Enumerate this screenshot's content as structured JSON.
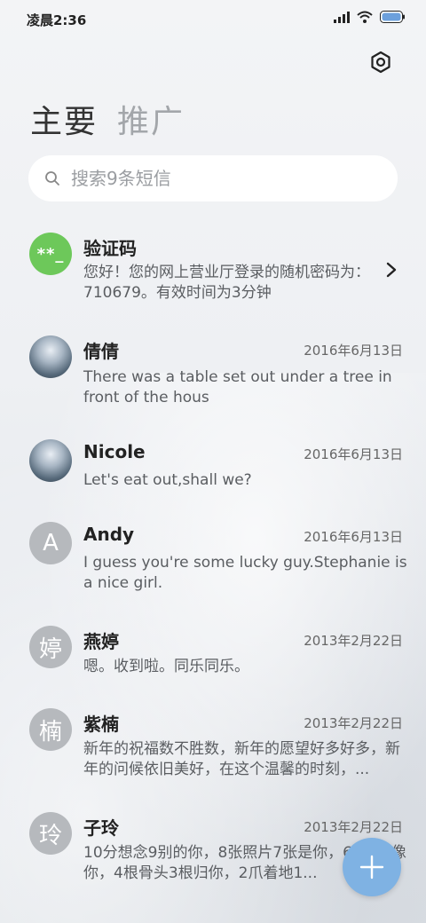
{
  "status_bar": {
    "time": "凌晨2:36"
  },
  "tabs": [
    {
      "label": "主要",
      "active": true
    },
    {
      "label": "推广",
      "active": false
    }
  ],
  "search": {
    "placeholder": "搜索9条短信"
  },
  "messages": [
    {
      "name": "验证码",
      "avatar_text": "**_",
      "avatar_type": "code",
      "date": "",
      "preview": "您好！您的网上营业厅登录的随机密码为：710679。有效时间为3分钟"
    },
    {
      "name": "倩倩",
      "avatar_text": "",
      "avatar_type": "photo",
      "date": "2016年6月13日",
      "preview": "There was a table set out under a tree in front of the hous"
    },
    {
      "name": "Nicole",
      "avatar_text": "",
      "avatar_type": "photo",
      "date": "2016年6月13日",
      "preview": "Let's eat out,shall we?"
    },
    {
      "name": "Andy",
      "avatar_text": "A",
      "avatar_type": "letter",
      "date": "2016年6月13日",
      "preview": "I guess you're some lucky guy.Stephanie is a nice girl."
    },
    {
      "name": "燕婷",
      "avatar_text": "婷",
      "avatar_type": "letter",
      "date": "2013年2月22日",
      "preview": "嗯。收到啦。同乐同乐。"
    },
    {
      "name": "紫楠",
      "avatar_text": "楠",
      "avatar_type": "letter",
      "date": "2013年2月22日",
      "preview": "新年的祝福数不胜数，新年的愿望好多好多，新年的问候依旧美好，在这个温馨的时刻，..."
    },
    {
      "name": "子玲",
      "avatar_text": "玲",
      "avatar_type": "letter",
      "date": "2013年2月22日",
      "preview": "10分想念9别的你，8张照片7张是你，6...5只像你，4根骨头3根归你，2爪着地1..."
    }
  ],
  "icons": {
    "settings": "settings-icon",
    "search": "search-icon",
    "chevron": "chevron-right-icon",
    "fab": "plus-icon"
  },
  "colors": {
    "code_avatar": "#6dc85a",
    "letter_avatar": "#b6b9bd",
    "fab": "#7fb2e3"
  }
}
